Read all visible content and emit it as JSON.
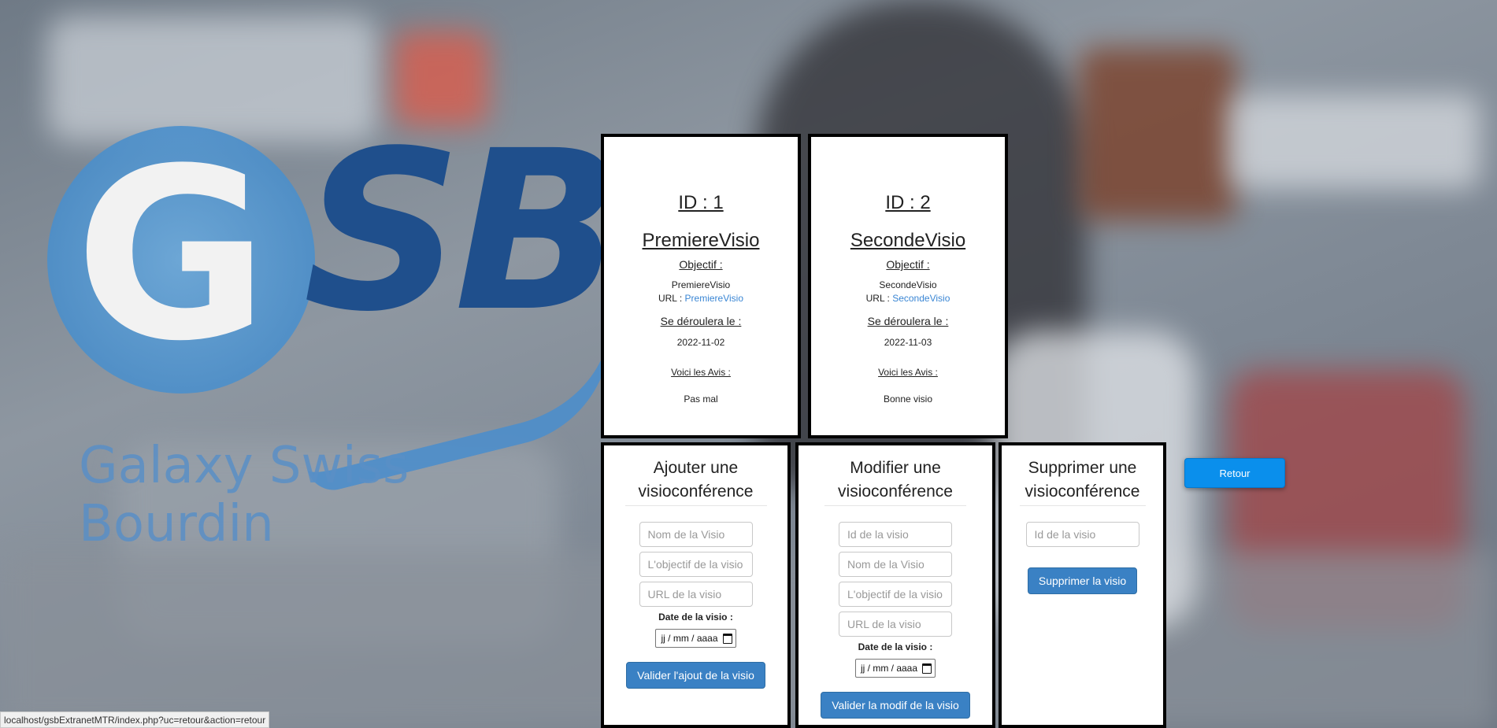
{
  "logo": {
    "letters_g": "G",
    "letters_sb": "SB",
    "company_name": "Galaxy Swiss Bourdin"
  },
  "visios": [
    {
      "id_label": "ID : 1",
      "name": "PremiereVisio",
      "objectif_label": "Objectif :",
      "objectif": "PremiereVisio",
      "url_label": "URL :",
      "url_text": "PremiereVisio",
      "date_label": "Se déroulera le :",
      "date": "2022-11-02",
      "avis_label": "Voici les Avis :",
      "avis": "Pas mal"
    },
    {
      "id_label": "ID : 2",
      "name": "SecondeVisio",
      "objectif_label": "Objectif :",
      "objectif": "SecondeVisio",
      "url_label": "URL :",
      "url_text": "SecondeVisio",
      "date_label": "Se déroulera le :",
      "date": "2022-11-03",
      "avis_label": "Voici les Avis :",
      "avis": "Bonne visio"
    }
  ],
  "form_add": {
    "title_line1": "Ajouter une",
    "title_line2": "visioconférence",
    "name_placeholder": "Nom de la Visio",
    "objectif_placeholder": "L'objectif de la visio",
    "url_placeholder": "URL de la visio",
    "date_label": "Date de la visio :",
    "date_placeholder": "jj / mm / aaaa",
    "submit_label": "Valider l'ajout de la visio"
  },
  "form_edit": {
    "title_line1": "Modifier une",
    "title_line2": "visioconférence",
    "id_placeholder": "Id de la visio",
    "name_placeholder": "Nom de la Visio",
    "objectif_placeholder": "L'objectif de la visio",
    "url_placeholder": "URL de la visio",
    "date_label": "Date de la visio :",
    "date_placeholder": "jj / mm / aaaa",
    "submit_label": "Valider la modif de la visio"
  },
  "form_delete": {
    "title_line1": "Supprimer une",
    "title_line2": "visioconférence",
    "id_placeholder": "Id de la visio",
    "submit_label": "Supprimer la visio"
  },
  "retour_label": "Retour",
  "status_url": "localhost/gsbExtranetMTR/index.php?uc=retour&action=retour",
  "colors": {
    "primary_button": "#3a81c4",
    "retour_button": "#0a8fec",
    "link": "#3a86d4"
  }
}
